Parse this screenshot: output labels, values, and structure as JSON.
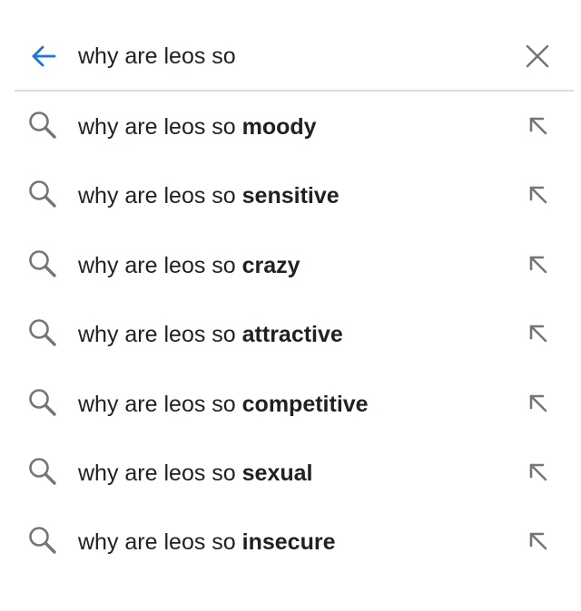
{
  "search": {
    "query": "why are leos so",
    "back_icon": "arrow-left-icon",
    "clear_icon": "close-icon",
    "accent_color": "#1a73e8",
    "icon_color": "#757575"
  },
  "suggestions": [
    {
      "prefix": "why are leos so ",
      "completion": "moody",
      "icon": "search-icon",
      "action_icon": "arrow-up-left-icon"
    },
    {
      "prefix": "why are leos so ",
      "completion": "sensitive",
      "icon": "search-icon",
      "action_icon": "arrow-up-left-icon"
    },
    {
      "prefix": "why are leos so ",
      "completion": "crazy",
      "icon": "search-icon",
      "action_icon": "arrow-up-left-icon"
    },
    {
      "prefix": "why are leos so ",
      "completion": "attractive",
      "icon": "search-icon",
      "action_icon": "arrow-up-left-icon"
    },
    {
      "prefix": "why are leos so ",
      "completion": "competitive",
      "icon": "search-icon",
      "action_icon": "arrow-up-left-icon"
    },
    {
      "prefix": "why are leos so ",
      "completion": "sexual",
      "icon": "search-icon",
      "action_icon": "arrow-up-left-icon"
    },
    {
      "prefix": "why are leos so ",
      "completion": "insecure",
      "icon": "search-icon",
      "action_icon": "arrow-up-left-icon"
    }
  ]
}
